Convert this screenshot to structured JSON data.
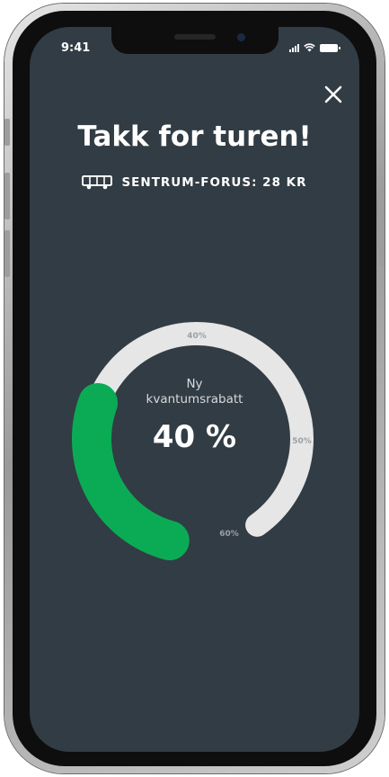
{
  "status_bar": {
    "time": "9:41"
  },
  "header": {
    "title": "Takk for turen!"
  },
  "route": {
    "label": "SENTRUM-FORUS: 28 KR",
    "icon": "bus-icon"
  },
  "discount": {
    "title_line1": "Ny",
    "title_line2": "kvantumsrabatt",
    "value_text": "40 %",
    "current_fraction": 0.4,
    "tick_labels": {
      "t40": "40%",
      "t50": "50%",
      "t60": "60%"
    }
  },
  "colors": {
    "background": "#323c44",
    "progress": "#0bab55",
    "track": "#e6e6e6",
    "text": "#ffffff"
  }
}
